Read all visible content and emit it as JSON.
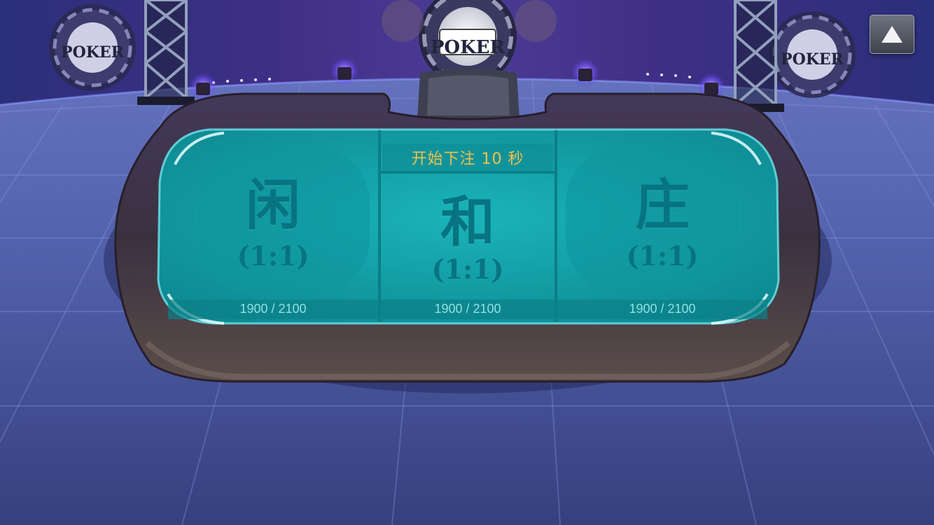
{
  "banner": {
    "logo_text": "POKER"
  },
  "countdown": {
    "text": "开始下注 10 秒"
  },
  "bet_zones": [
    {
      "name": "闲",
      "odds": "(1:1)",
      "bets": "1900 / 2100"
    },
    {
      "name": "和",
      "odds": "(1:1)",
      "bets": "1900 / 2100"
    },
    {
      "name": "庄",
      "odds": "(1:1)",
      "bets": "1900 / 2100"
    }
  ],
  "menu_button": {
    "icon": "up-triangle-icon"
  },
  "colors": {
    "table_felt": "#15a6ad",
    "table_rim": "#4a3f48",
    "floor": "#4f60a8",
    "countdown_text": "#f2c24a",
    "zone_text": "#087481",
    "bet_text": "#8fe0e4"
  }
}
